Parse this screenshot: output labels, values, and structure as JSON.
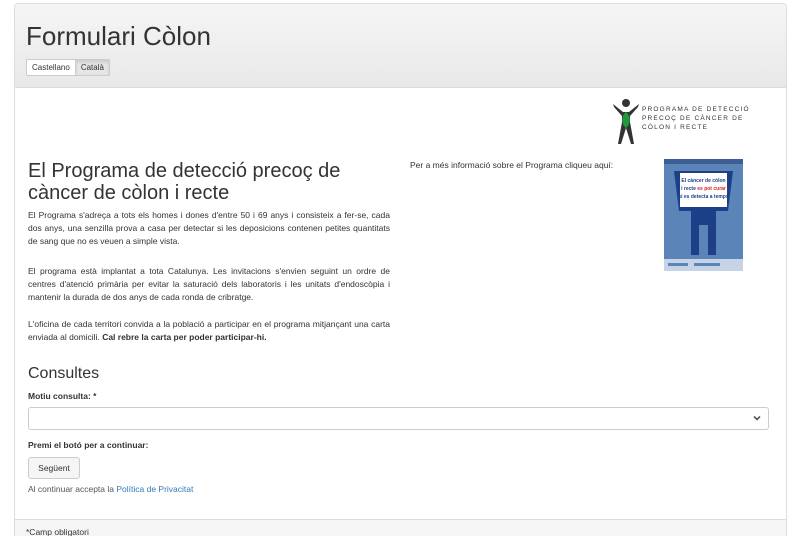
{
  "header": {
    "title": "Formulari Còlon",
    "languages": [
      "Castellano",
      "Català"
    ],
    "active_language": "Català"
  },
  "logo": {
    "line1": "PROGRAMA DE DETECCIÓ",
    "line2": "PRECOÇ DE CÀNCER DE",
    "line3": "CÒLON I RECTE",
    "color_green": "#1f9a3c",
    "color_dark": "#333333"
  },
  "intro": {
    "heading": "El Programa de detecció precoç de càncer de còlon i recte",
    "paragraph1": "El Programa s'adreça a tots els homes i dones d'entre 50 i 69 anys i consisteix a fer-se, cada dos anys, una senzilla prova a casa per detectar si les deposicions contenen petites quantitats de sang que no es veuen a simple vista.",
    "paragraph2": "El programa està implantat a tota Catalunya. Les invitacions s'envien seguint un ordre de centres d'atenció primària per evitar la saturació dels laboratoris i les unitats d'endoscòpia i mantenir la durada de dos anys de cada ronda de cribratge.",
    "paragraph3_plain": "L'oficina de cada territori convida a la població a participar en el programa mitjançant una carta enviada al domicili. ",
    "paragraph3_bold": "Cal rebre la carta per poder participar-hi."
  },
  "info": {
    "text": "Per a més informació sobre el Programa cliqueu aquí:",
    "brochure": {
      "line1": "El càncer de còlon",
      "line2a": "i recte ",
      "line2b": "es pot curar",
      "line3": "si es detecta a temps",
      "color_bg": "#5b84b8",
      "color_figure": "#1d3f87"
    }
  },
  "form": {
    "section_title": "Consultes",
    "reason_label": "Motiu consulta: *",
    "reason_value": "",
    "continue_label": "Premi el botó per a continuar:",
    "next_button": "Següent",
    "privacy_prefix": "Al continuar accepta la ",
    "privacy_link": "Política de Privacitat"
  },
  "footer": {
    "required_note": "*Camp obligatori"
  },
  "colors": {
    "link": "#337ab7",
    "header_bg": "#ececec",
    "border": "#dddddd"
  }
}
